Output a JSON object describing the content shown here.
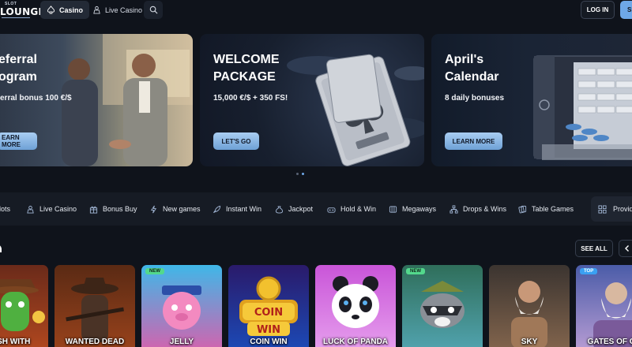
{
  "header": {
    "logo_top": "SLOT",
    "logo_main": "LOUNGE",
    "nav": [
      {
        "label": "Casino",
        "icon": "spade-icon",
        "active": true
      },
      {
        "label": "Live Casino",
        "icon": "dealer-icon",
        "active": false
      }
    ],
    "search_icon": "search-icon",
    "login_label": "LOG IN",
    "signup_label": "SI"
  },
  "banners": [
    {
      "title": "eferral\nogram",
      "subtitle": "erral bonus 100 €/$",
      "cta": "EARN MORE"
    },
    {
      "title": "WELCOME\nPACKAGE",
      "subtitle": "15,000 €/$ + 350 FS!",
      "cta": "LET'S GO"
    },
    {
      "title": "April's\nCalendar",
      "subtitle": "8 daily bonuses",
      "cta": "LEARN MORE"
    }
  ],
  "carousel": {
    "count": 2,
    "active_index": 1
  },
  "categories": [
    {
      "label": "lots",
      "icon": "slots-icon"
    },
    {
      "label": "Live Casino",
      "icon": "dealer-icon"
    },
    {
      "label": "Bonus Buy",
      "icon": "gift-icon"
    },
    {
      "label": "New games",
      "icon": "lightning-icon"
    },
    {
      "label": "Instant Win",
      "icon": "rocket-icon"
    },
    {
      "label": "Jackpot",
      "icon": "money-bag-icon"
    },
    {
      "label": "Hold & Win",
      "icon": "joystick-icon"
    },
    {
      "label": "Megaways",
      "icon": "megaways-icon"
    },
    {
      "label": "Drops & Wins",
      "icon": "drops-icon"
    },
    {
      "label": "Table Games",
      "icon": "cards-icon"
    }
  ],
  "providers_label": "Provid",
  "games_section": {
    "see_all": "SEE ALL",
    "tiles": [
      {
        "name": "RUSH WITH",
        "tag": "",
        "colors": [
          "#6a2a1a",
          "#b84b1f"
        ]
      },
      {
        "name": "WANTED DEAD",
        "tag": "",
        "colors": [
          "#5a2a14",
          "#a0451c"
        ]
      },
      {
        "name": "JELLY",
        "tag": "NEW",
        "colors": [
          "#3fb7e8",
          "#e25aa8"
        ]
      },
      {
        "name": "COIN WIN",
        "tag": "",
        "colors": [
          "#2a1a6a",
          "#1a4fbf"
        ]
      },
      {
        "name": "LUCK OF PANDA",
        "tag": "",
        "colors": [
          "#c955d8",
          "#e9a6f0"
        ]
      },
      {
        "name": "",
        "tag": "NEW",
        "colors": [
          "#2f6e5a",
          "#55a9b8"
        ]
      },
      {
        "name": "SKY",
        "tag": "",
        "colors": [
          "#3b3430",
          "#8a6a50"
        ]
      },
      {
        "name": "GATES OF OLY",
        "tag": "TOP",
        "colors": [
          "#4a5ca8",
          "#c2a3d8"
        ]
      }
    ]
  }
}
